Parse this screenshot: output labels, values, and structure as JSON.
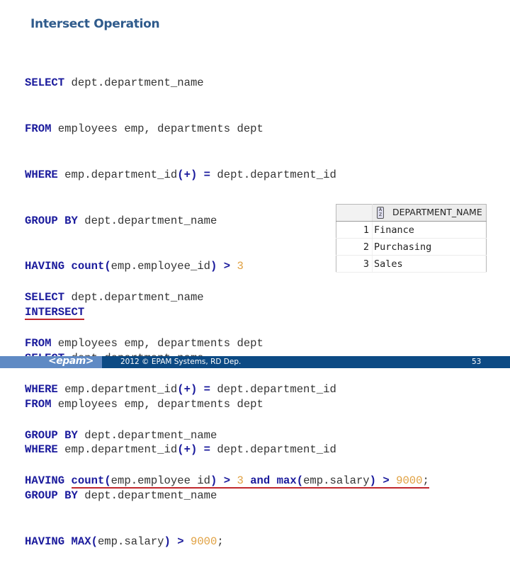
{
  "slide": {
    "title": "Intersect Operation"
  },
  "query1": {
    "lines": [
      {
        "kw": "SELECT",
        "rest": " dept.department_name"
      },
      {
        "kw": "FROM",
        "rest": " employees emp, departments dept"
      },
      {
        "kw": "WHERE",
        "rest_a": " emp.department_id",
        "op": "(+) =",
        "rest_b": " dept.department_id"
      },
      {
        "kw": "GROUP BY",
        "rest": " dept.department_name"
      },
      {
        "kw": "HAVING",
        "fn": "count",
        "paren_open": "(",
        "arg": "emp.employee_id",
        "paren_close": ")",
        "gt": " >",
        "num": "3"
      },
      {
        "kw": "INTERSECT"
      },
      {
        "kw": "SELECT",
        "rest": " dept.department_name"
      },
      {
        "kw": "FROM",
        "rest": " employees emp, departments dept"
      },
      {
        "kw": "WHERE",
        "rest_a": " emp.department_id",
        "op": "(+) =",
        "rest_b": " dept.department_id"
      },
      {
        "kw": "GROUP BY",
        "rest": " dept.department_name"
      },
      {
        "kw": "HAVING",
        "fn": "MAX",
        "paren_open": "(",
        "arg": "emp.salary",
        "paren_close": ")",
        "gt": " >",
        "num": "9000",
        "end": ";"
      }
    ]
  },
  "query2": {
    "lines": [
      {
        "kw": "SELECT",
        "rest": " dept.department_name"
      },
      {
        "kw": "FROM",
        "rest": " employees emp, departments dept"
      },
      {
        "kw": "WHERE",
        "rest_a": " emp.department_id",
        "op": "(+) =",
        "rest_b": " dept.department_id"
      },
      {
        "kw": "GROUP BY",
        "rest": " dept.department_name"
      },
      {
        "kw": "HAVING",
        "fn": "count",
        "paren_open": "(",
        "arg": "emp.employee id",
        "paren_close": ")",
        "gt": " >",
        "num": "3",
        "and": "and",
        "fn2": "max",
        "arg2": "emp.salary",
        "num2": "9000",
        "end": ";"
      }
    ]
  },
  "result": {
    "column_header": "DEPARTMENT_NAME",
    "sort_icon": "sort-az-icon",
    "rows": [
      {
        "num": "1",
        "value": "Finance"
      },
      {
        "num": "2",
        "value": "Purchasing"
      },
      {
        "num": "3",
        "value": "Sales"
      }
    ]
  },
  "footer": {
    "logo": "<epam>",
    "copyright": "2012 © EPAM Systems, RD Dep.",
    "page_number": "53"
  },
  "colors": {
    "keyword": "#1a1a9c",
    "number": "#e0a040",
    "highlight_underline": "#c0272d",
    "title": "#2f5b8c",
    "footer_dark": "#0c4a84",
    "footer_light": "#5f8ac4"
  }
}
